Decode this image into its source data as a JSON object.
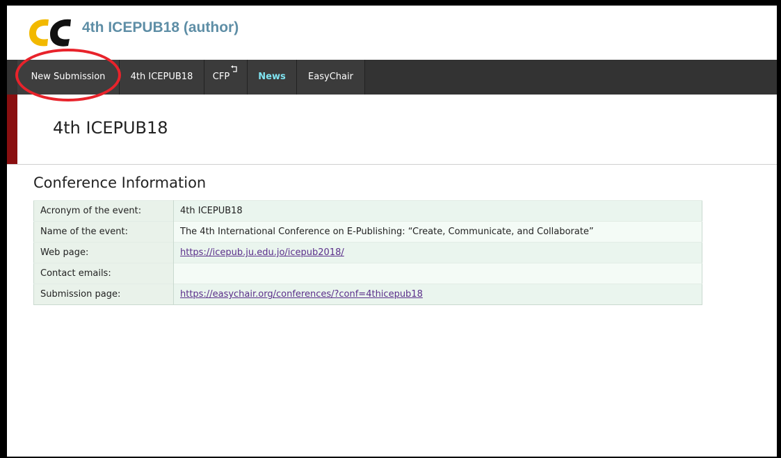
{
  "header": {
    "title": "4th ICEPUB18 (author)"
  },
  "logo": {
    "colors": {
      "left": "#f2b900",
      "right": "#111111"
    }
  },
  "menu": {
    "items": [
      {
        "label": "New Submission",
        "highlighted": true
      },
      {
        "label": "4th ICEPUB18"
      },
      {
        "label": "CFP",
        "icon": "return-arrow-icon"
      },
      {
        "label": "News"
      },
      {
        "label": "EasyChair"
      }
    ]
  },
  "page": {
    "title": "4th ICEPUB18"
  },
  "conference": {
    "section_title": "Conference Information",
    "rows": [
      {
        "label": "Acronym of the event:",
        "value": "4th ICEPUB18"
      },
      {
        "label": "Name of the event:",
        "value": "The 4th International Conference on E-Publishing: “Create, Communicate, and Collaborate”"
      },
      {
        "label": "Web page:",
        "value": "https://icepub.ju.edu.jo/icepub2018/"
      },
      {
        "label": "Contact emails:",
        "value": ""
      },
      {
        "label": "Submission page:",
        "value": "https://easychair.org/conferences/?conf=4thicepub18"
      }
    ]
  },
  "colors": {
    "accent": "#8a0f10",
    "menu_bg": "#333333",
    "news": "#7fe3f0",
    "title": "#5e8ea6",
    "highlight": "#e8232b"
  }
}
